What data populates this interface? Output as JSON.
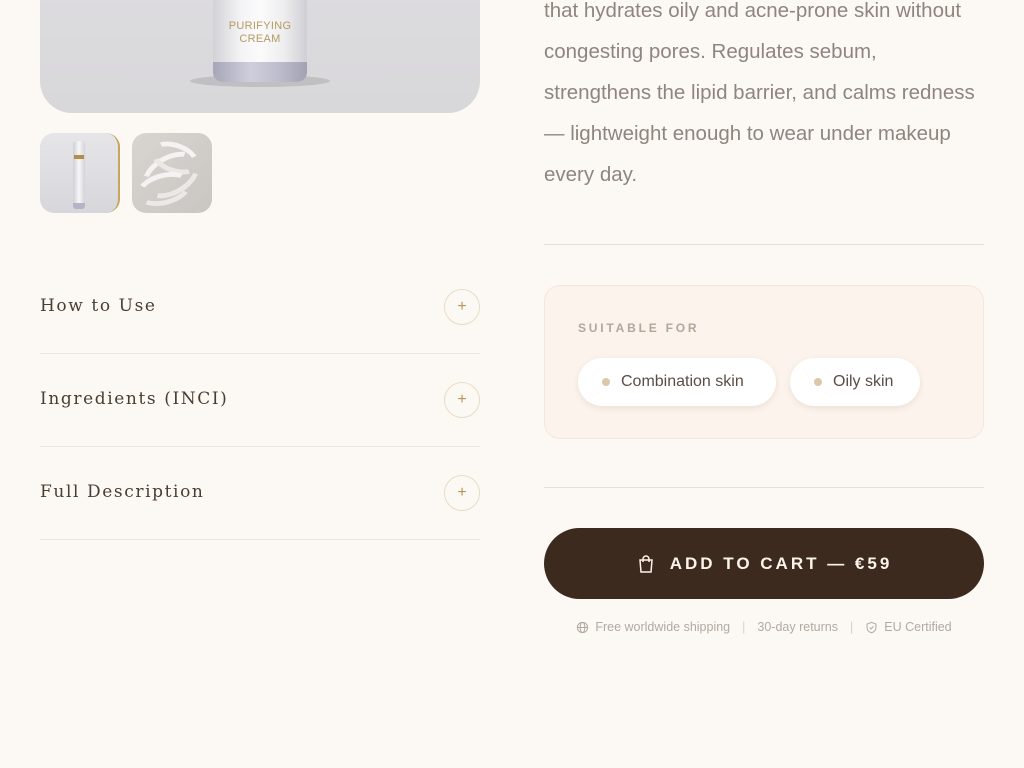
{
  "product": {
    "bottle_label": "PURIFYING\nCREAM",
    "description": "that hydrates oily and acne-prone skin without congesting pores. Regulates sebum, strengthens the lipid barrier, and calms redness — lightweight enough to wear under makeup every day."
  },
  "accordion": [
    {
      "label": "How to Use",
      "toggle": "+"
    },
    {
      "label": "Ingredients (INCI)",
      "toggle": "+"
    },
    {
      "label": "Full Description",
      "toggle": "+"
    }
  ],
  "suitable": {
    "title": "SUITABLE FOR",
    "chips": [
      "Combination skin",
      "Oily skin"
    ]
  },
  "cart": {
    "label": "ADD TO CART — €59",
    "icon": "shopping-bag-icon"
  },
  "perks": [
    {
      "icon": "globe-icon",
      "text": "Free worldwide shipping"
    },
    {
      "icon": "",
      "text": "30-day returns"
    },
    {
      "icon": "shield-icon",
      "text": "EU Certified"
    }
  ],
  "colors": {
    "background": "#fcf9f4",
    "accent_gold": "#c6a65e",
    "button_dark": "#3d2a1f",
    "suitable_bg": "#fbf3ec"
  }
}
